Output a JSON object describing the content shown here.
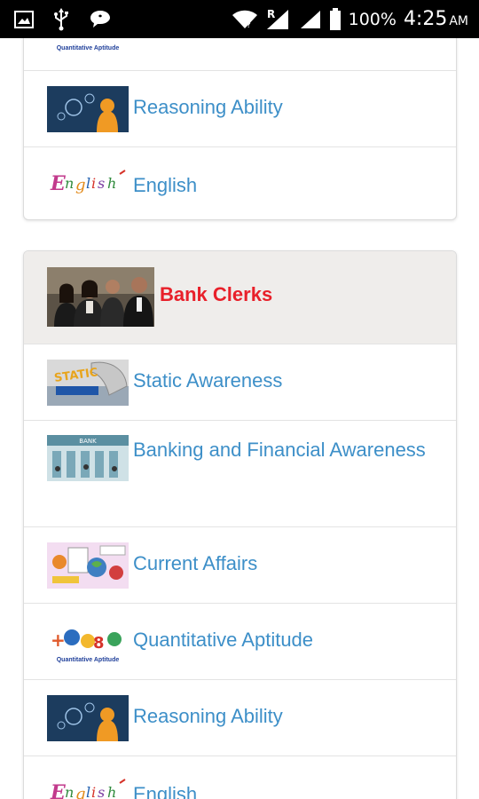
{
  "status_bar": {
    "battery": "100%",
    "time": "4:25",
    "ampm": "AM",
    "icons": [
      "image-icon",
      "usb-icon",
      "chat-icon",
      "wifi-icon",
      "signal-icon",
      "battery-icon"
    ],
    "roaming_letter": "R"
  },
  "card1": {
    "partial_thumb_caption": "Quantitative Aptitude",
    "items": [
      {
        "label": "Reasoning Ability",
        "icon": "reasoning-thumbnail"
      },
      {
        "label": "English",
        "icon": "english-thumbnail"
      }
    ]
  },
  "card2": {
    "header": {
      "label": "Bank Clerks",
      "icon": "bank-clerks-photo"
    },
    "items": [
      {
        "label": "Static Awareness",
        "icon": "static-awareness-thumbnail",
        "thumb_text": "STATIC"
      },
      {
        "label": "Banking and Financial Awareness",
        "icon": "banking-thumbnail",
        "thumb_text": "BANK"
      },
      {
        "label": "Current Affairs",
        "icon": "current-affairs-thumbnail"
      },
      {
        "label": "Quantitative Aptitude",
        "icon": "quant-thumbnail",
        "thumb_caption": "Quantitative Aptitude"
      },
      {
        "label": "Reasoning Ability",
        "icon": "reasoning-thumbnail"
      },
      {
        "label": "English",
        "icon": "english-thumbnail"
      }
    ]
  },
  "colors": {
    "link_blue": "#3d8fc8",
    "header_red": "#e8202a",
    "header_bg": "#efedeb",
    "status_bar_bg": "#000000"
  }
}
